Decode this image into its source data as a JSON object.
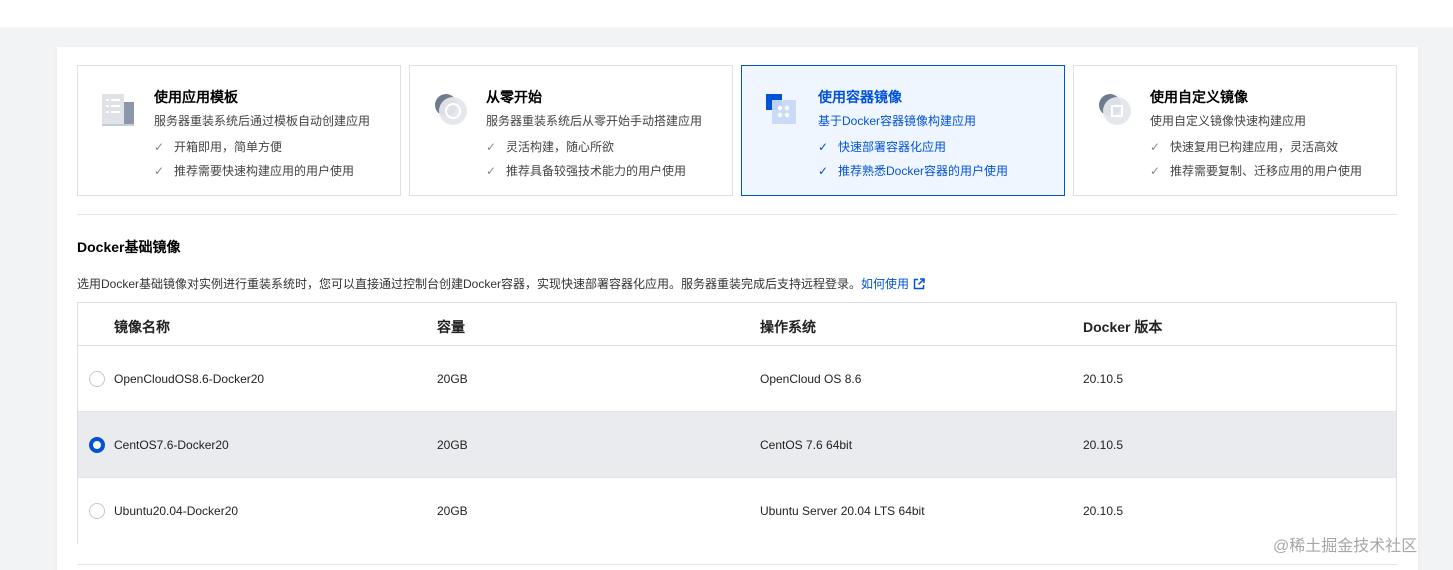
{
  "cards": [
    {
      "title": "使用应用模板",
      "desc": "服务器重装系统后通过模板自动创建应用",
      "features": [
        "开箱即用，简单方便",
        "推荐需要快速构建应用的用户使用"
      ],
      "icon": "app-template-icon"
    },
    {
      "title": "从零开始",
      "desc": "服务器重装系统后从零开始手动搭建应用",
      "features": [
        "灵活构建，随心所欲",
        "推荐具备较强技术能力的用户使用"
      ],
      "icon": "blank-start-icon"
    },
    {
      "title": "使用容器镜像",
      "desc": "基于Docker容器镜像构建应用",
      "features": [
        "快速部署容器化应用",
        "推荐熟悉Docker容器的用户使用"
      ],
      "icon": "container-image-icon"
    },
    {
      "title": "使用自定义镜像",
      "desc": "使用自定义镜像快速构建应用",
      "features": [
        "快速复用已构建应用，灵活高效",
        "推荐需要复制、迁移应用的用户使用"
      ],
      "icon": "custom-image-icon"
    }
  ],
  "selected_card": 2,
  "section": {
    "title": "Docker基础镜像",
    "desc": "选用Docker基础镜像对实例进行重装系统时，您可以直接通过控制台创建Docker容器，实现快速部署容器化应用。服务器重装完成后支持远程登录。",
    "link": "如何使用"
  },
  "table": {
    "headers": [
      "镜像名称",
      "容量",
      "操作系统",
      "Docker 版本"
    ],
    "rows": [
      {
        "name": "OpenCloudOS8.6-Docker20",
        "size": "20GB",
        "os": "OpenCloud OS 8.6",
        "docker": "20.10.5"
      },
      {
        "name": "CentOS7.6-Docker20",
        "size": "20GB",
        "os": "CentOS 7.6 64bit",
        "docker": "20.10.5"
      },
      {
        "name": "Ubuntu20.04-Docker20",
        "size": "20GB",
        "os": "Ubuntu Server 20.04 LTS 64bit",
        "docker": "20.10.5"
      }
    ],
    "selected_row": 1
  },
  "watermark": "@稀土掘金技术社区",
  "colors": {
    "accent": "#0052d9",
    "selected_row_bg": "#e9ebee",
    "selected_card_bg": "#f0f6ff"
  }
}
